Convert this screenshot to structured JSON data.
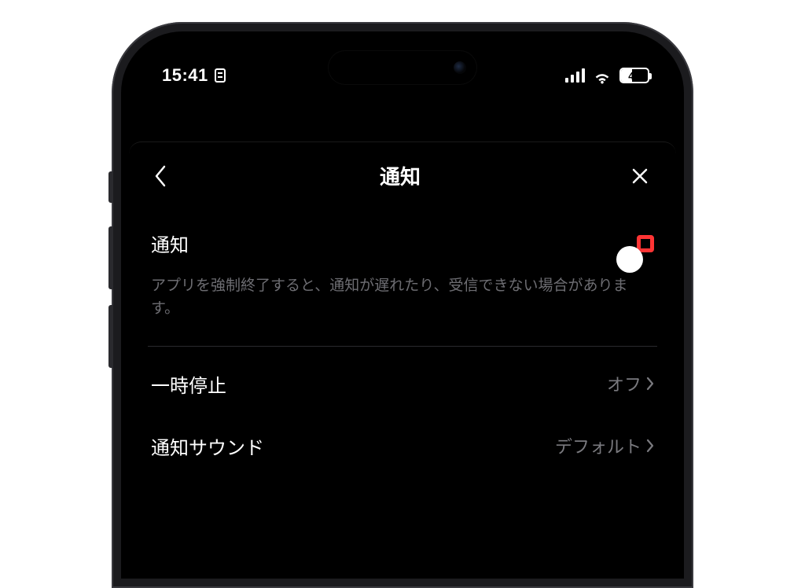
{
  "statusbar": {
    "time": "15:41",
    "battery": "42"
  },
  "header": {
    "title": "通知"
  },
  "notif": {
    "label": "通知",
    "desc": "アプリを強制終了すると、通知が遅れたり、受信できない場合があります。",
    "toggle_on": true
  },
  "rows": {
    "pause": {
      "label": "一時停止",
      "value": "オフ"
    },
    "sound": {
      "label": "通知サウンド",
      "value": "デフォルト"
    }
  },
  "colors": {
    "accent_green": "#1ec755",
    "highlight_red": "#ff3434"
  }
}
